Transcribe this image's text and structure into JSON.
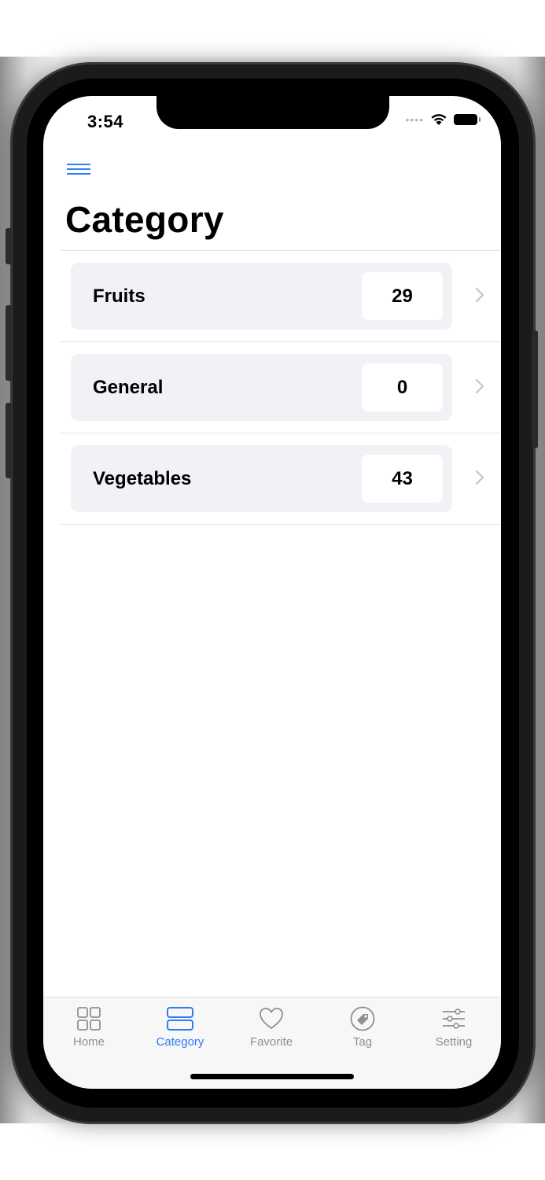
{
  "status_bar": {
    "time": "3:54"
  },
  "header": {
    "menu_icon": "hamburger-menu-icon",
    "title": "Category"
  },
  "categories": [
    {
      "name": "Fruits",
      "count": "29"
    },
    {
      "name": "General",
      "count": "0"
    },
    {
      "name": "Vegetables",
      "count": "43"
    }
  ],
  "tab_bar": {
    "tabs": [
      {
        "label": "Home",
        "icon": "grid-icon",
        "active": false
      },
      {
        "label": "Category",
        "icon": "stacked-rectangles-icon",
        "active": true
      },
      {
        "label": "Favorite",
        "icon": "heart-icon",
        "active": false
      },
      {
        "label": "Tag",
        "icon": "tag-icon",
        "active": false
      },
      {
        "label": "Setting",
        "icon": "sliders-icon",
        "active": false
      }
    ]
  },
  "colors": {
    "accent": "#2f7cf6",
    "inactive": "#8f8f94",
    "card_bg": "#f2f2f6"
  }
}
